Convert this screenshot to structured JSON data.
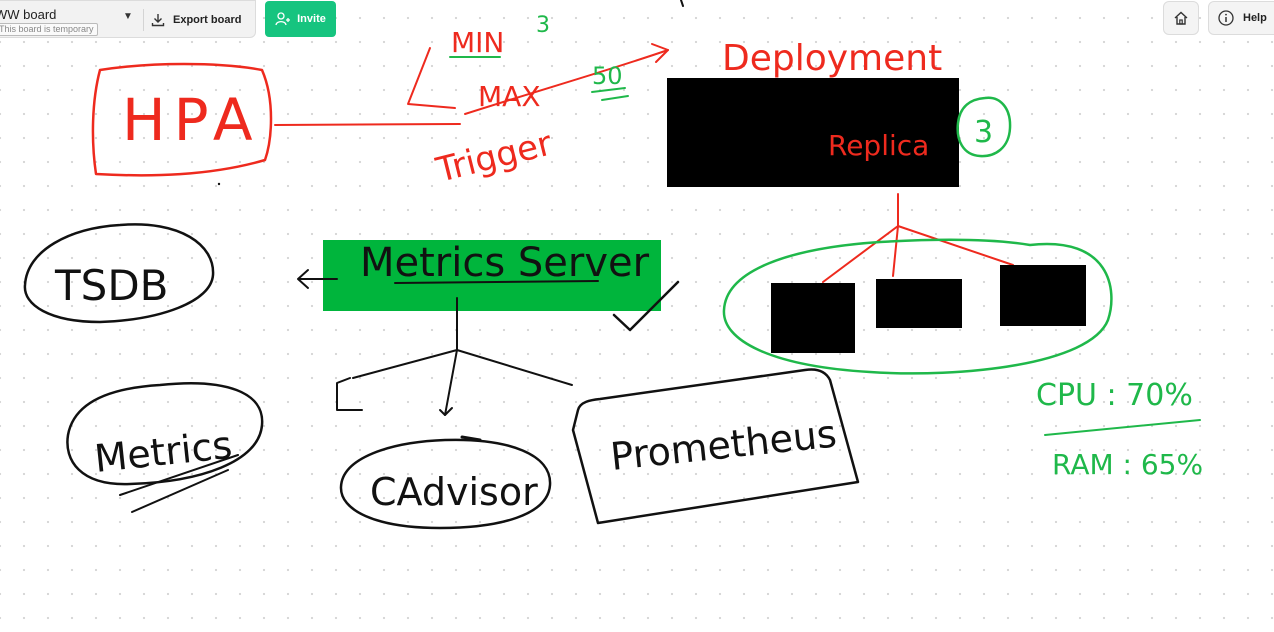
{
  "toolbar": {
    "board_name": "WW board",
    "temp_notice": "This board is temporary",
    "export_label": "Export board",
    "invite_label": "Invite",
    "help_label": "Help"
  },
  "canvas": {
    "red_text": {
      "hpa": "HPA",
      "min": "MIN",
      "max": "MAX",
      "trigger": "Trigger",
      "deployment": "Deployment",
      "replica": "Replica"
    },
    "green_text": {
      "min_value": "3",
      "max_value": "50",
      "replica_count": "3",
      "cpu": "CPU : 70%",
      "ram": "RAM : 65%"
    },
    "black_text": {
      "metrics_server": "Metrics Server",
      "tsdb": "TSDB",
      "metrics": "Metrics",
      "cadvisor": "CAdvisor",
      "prometheus": "Prometheus"
    },
    "colors": {
      "ink_red": "#ee2a1e",
      "ink_green": "#1fb84a",
      "ink_black": "#111111",
      "metrics_server_fill": "#00b53c",
      "invite_button": "#16c47f"
    }
  }
}
